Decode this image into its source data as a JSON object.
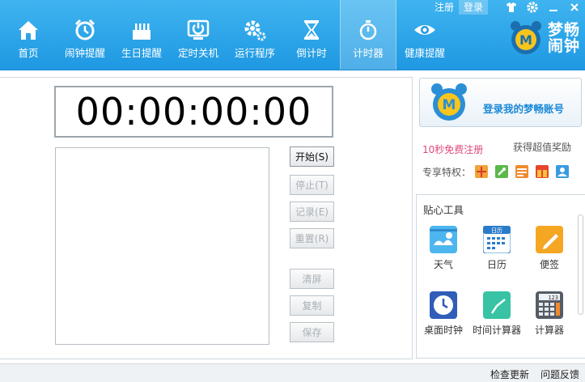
{
  "nav": {
    "items": [
      {
        "label": "首页",
        "icon": "home-icon"
      },
      {
        "label": "闹钟提醒",
        "icon": "alarm-clock-icon"
      },
      {
        "label": "生日提醒",
        "icon": "birthday-cake-icon"
      },
      {
        "label": "定时关机",
        "icon": "power-icon"
      },
      {
        "label": "运行程序",
        "icon": "gear-icon"
      },
      {
        "label": "倒计时",
        "icon": "hourglass-icon"
      },
      {
        "label": "计时器",
        "icon": "stopwatch-icon",
        "active": true
      },
      {
        "label": "健康提醒",
        "icon": "eye-icon"
      }
    ]
  },
  "topright": {
    "register": "注册",
    "login": "登录",
    "icons": [
      "skin-icon",
      "settings-icon",
      "minimize-icon",
      "close-icon"
    ]
  },
  "brand": {
    "line1": "梦畅",
    "line2": "闹钟"
  },
  "timer": {
    "display": "00:00:00:00",
    "buttons": {
      "start": "开始(S)",
      "stop": "停止(T)",
      "record": "记录(E)",
      "reset": "重置(R)",
      "clear": "清屏",
      "copy": "复制",
      "save": "保存"
    }
  },
  "account": {
    "login_text": "登录我的梦畅账号",
    "register_link": "10秒免费注册",
    "reward_link": "获得超值奖励",
    "privilege_label": "专享特权：",
    "privilege_icons": [
      "gift-icon",
      "rocket-icon",
      "calendar-card-icon",
      "present-icon",
      "user-cloud-icon"
    ]
  },
  "tools": {
    "title": "贴心工具",
    "items": [
      {
        "label": "天气",
        "icon": "weather-icon"
      },
      {
        "label": "日历",
        "icon": "calendar-icon",
        "badge": "日历"
      },
      {
        "label": "便签",
        "icon": "note-icon"
      },
      {
        "label": "桌面时钟",
        "icon": "desk-clock-icon"
      },
      {
        "label": "时间计算器",
        "icon": "time-calculator-icon"
      },
      {
        "label": "计算器",
        "icon": "calculator-icon",
        "badge": "123"
      }
    ]
  },
  "status": {
    "check_update": "检查更新",
    "feedback": "问题反馈"
  },
  "colors": {
    "header": "#1e98e2",
    "accent": "#1a88d6",
    "register_pink": "#e0487a"
  }
}
